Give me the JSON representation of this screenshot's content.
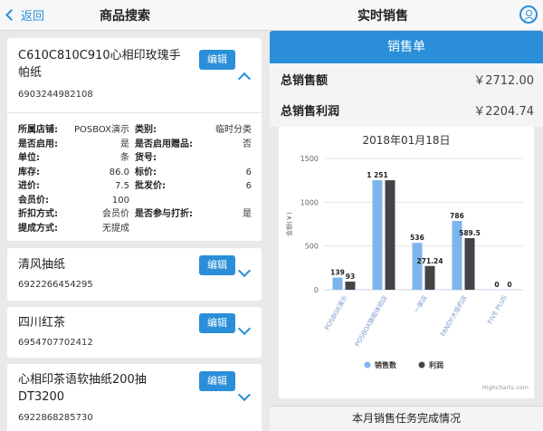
{
  "header": {
    "back_label": "返回",
    "left_title": "商品搜索",
    "right_title": "实时销售"
  },
  "products": [
    {
      "name_line1": "C610C810C910心相印玫瑰手",
      "name_line2": "帕纸",
      "code": "6903244982108",
      "edit_label": "编辑",
      "expanded": true,
      "details": [
        [
          {
            "label": "所属店铺:",
            "value": "POSBOX演示"
          },
          {
            "label": "类别:",
            "value": "临时分类"
          }
        ],
        [
          {
            "label": "是否启用:",
            "value": "是"
          },
          {
            "label": "是否启用赠品:",
            "value": "否"
          }
        ],
        [
          {
            "label": "单位:",
            "value": "条"
          },
          {
            "label": "货号:",
            "value": ""
          }
        ],
        [
          {
            "label": "库存:",
            "value": "86.0"
          },
          {
            "label": "标价:",
            "value": "6"
          }
        ],
        [
          {
            "label": "进价:",
            "value": "7.5"
          },
          {
            "label": "批发价:",
            "value": "6"
          }
        ],
        [
          {
            "label": "会员价:",
            "value": "100"
          },
          {
            "label": "",
            "value": ""
          }
        ],
        [
          {
            "label": "折扣方式:",
            "value": "会员价"
          },
          {
            "label": "是否参与打折:",
            "value": "是"
          }
        ],
        [
          {
            "label": "提成方式:",
            "value": "无提成"
          },
          {
            "label": "",
            "value": ""
          }
        ]
      ]
    },
    {
      "name_line1": "清风抽纸",
      "name_line2": "",
      "code": "6922266454295",
      "edit_label": "编辑",
      "expanded": false
    },
    {
      "name_line1": "四川红茶",
      "name_line2": "",
      "code": "6954707702412",
      "edit_label": "编辑",
      "expanded": false
    },
    {
      "name_line1": "心相印茶语软抽纸200抽",
      "name_line2": "DT3200",
      "code": "6922868285730",
      "edit_label": "编辑",
      "expanded": false
    }
  ],
  "sales": {
    "header_label": "销售单",
    "total_sales_label": "总销售额",
    "total_sales_value": "￥2712.00",
    "total_profit_label": "总销售利润",
    "total_profit_value": "￥2204.74",
    "task_label": "本月销售任务完成情况"
  },
  "chart_data": {
    "type": "bar",
    "title": "2018年01月18日",
    "ylabel": "金额(￥)",
    "ylim": [
      0,
      1500
    ],
    "yticks": [
      "0",
      "500",
      "1000",
      "1500"
    ],
    "categories": [
      "POSBOX演示",
      "POSBOX旗舰体验店",
      "一家店",
      "FANDY大饭的店",
      "FIVE PLUS"
    ],
    "series": [
      {
        "name": "销售数",
        "color": "#7cb5ec",
        "values": [
          139,
          1251,
          536,
          786,
          0
        ],
        "labels": [
          "139",
          "1 251",
          "536",
          "786",
          "0"
        ]
      },
      {
        "name": "利润",
        "color": "#434348",
        "values": [
          93,
          1251,
          271.24,
          589.5,
          0
        ],
        "labels": [
          "93",
          "",
          "271.24",
          "589.5",
          "0"
        ]
      }
    ],
    "grid": true,
    "legend": "bottom",
    "credits": "Highcharts.com"
  }
}
